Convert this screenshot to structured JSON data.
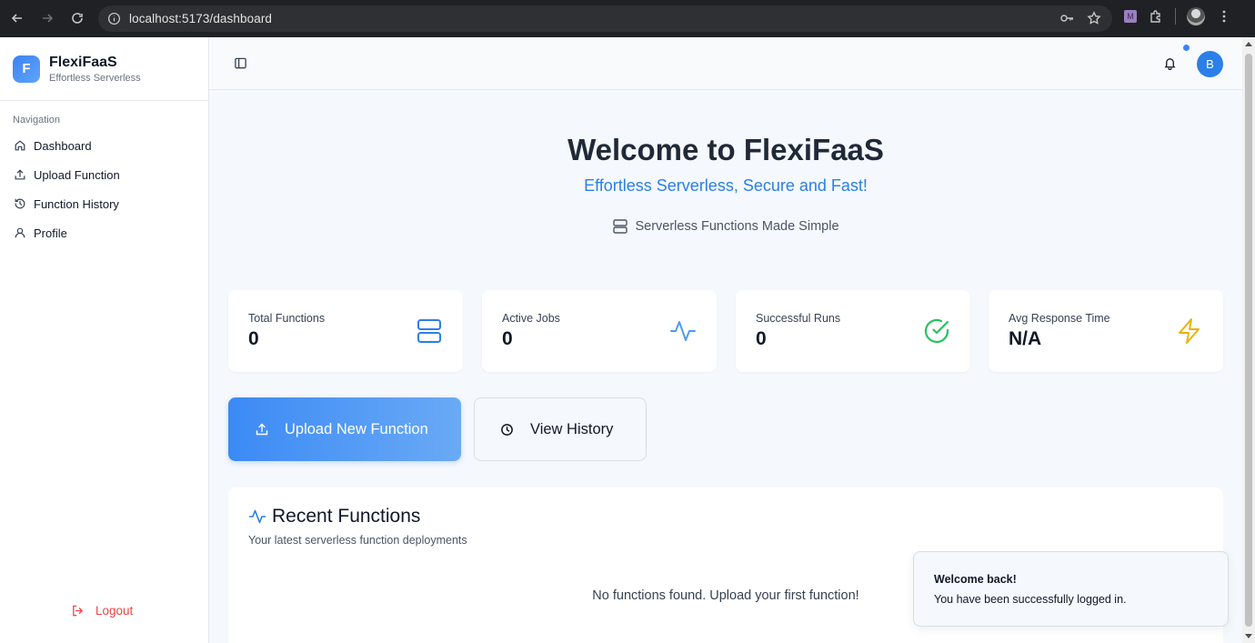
{
  "browser": {
    "url": "localhost:5173/dashboard",
    "extension_badge": "M"
  },
  "sidebar": {
    "brand_initial": "F",
    "brand_name": "FlexiFaaS",
    "brand_tagline": "Effortless Serverless",
    "nav_heading": "Navigation",
    "items": [
      {
        "label": "Dashboard",
        "icon": "home-icon"
      },
      {
        "label": "Upload Function",
        "icon": "upload-icon"
      },
      {
        "label": "Function History",
        "icon": "history-icon"
      },
      {
        "label": "Profile",
        "icon": "user-icon"
      }
    ],
    "logout_label": "Logout"
  },
  "header": {
    "avatar_initial": "B",
    "notification_dot": true
  },
  "hero": {
    "title": "Welcome to FlexiFaaS",
    "subtitle": "Effortless Serverless, Secure and Fast!",
    "tagline": "Serverless Functions Made Simple"
  },
  "stats": [
    {
      "label": "Total Functions",
      "value": "0",
      "icon": "server-icon",
      "color": "#2b7fe8"
    },
    {
      "label": "Active Jobs",
      "value": "0",
      "icon": "activity-icon",
      "color": "#4f9bf0"
    },
    {
      "label": "Successful Runs",
      "value": "0",
      "icon": "check-circle-icon",
      "color": "#22c55e"
    },
    {
      "label": "Avg Response Time",
      "value": "N/A",
      "icon": "zap-icon",
      "color": "#eab308"
    }
  ],
  "actions": {
    "upload_label": "Upload New Function",
    "history_label": "View History"
  },
  "recent": {
    "title": "Recent Functions",
    "subtitle": "Your latest serverless function deployments",
    "empty_message": "No functions found. Upload your first function!"
  },
  "toast": {
    "title": "Welcome back!",
    "message": "You have been successfully logged in."
  },
  "colors": {
    "accent": "#2b7fe8",
    "danger": "#ef4444",
    "background": "#f5f8fc"
  }
}
